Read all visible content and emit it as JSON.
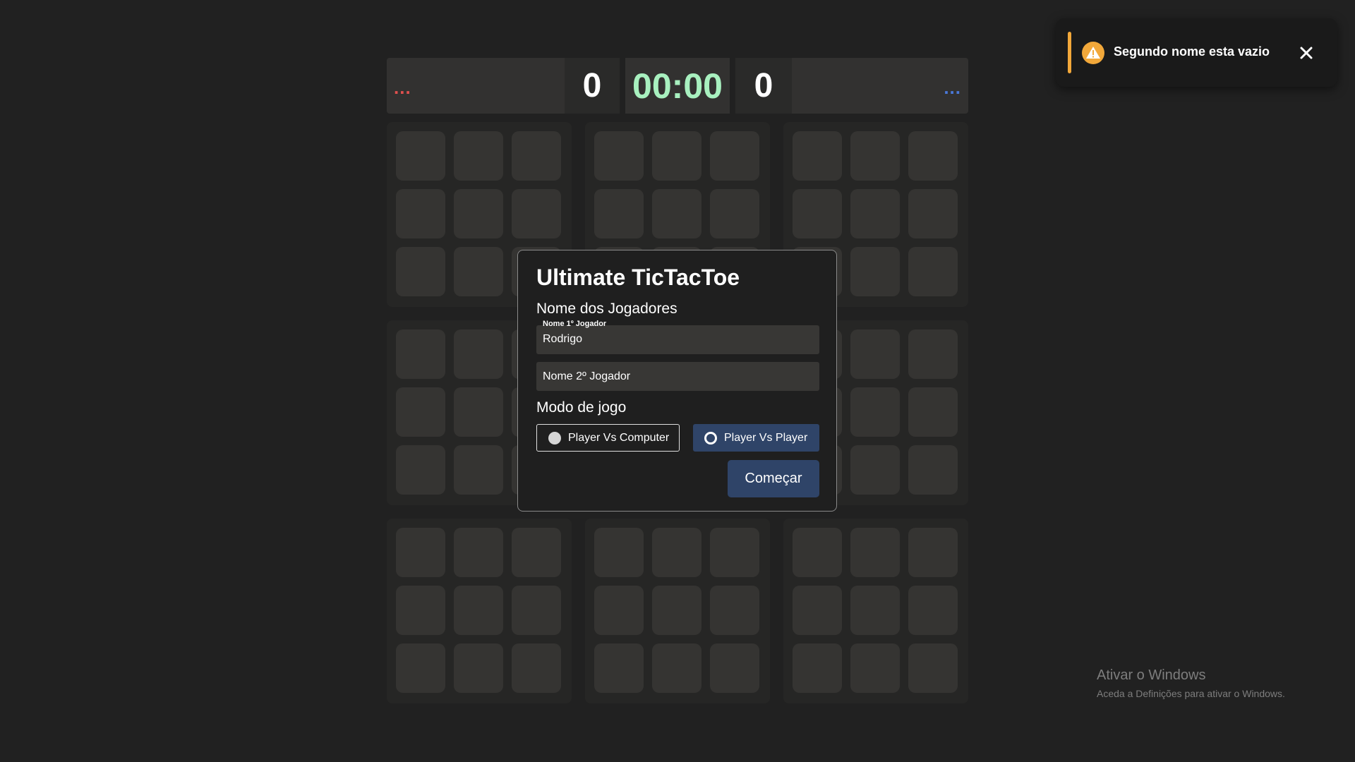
{
  "scoreboard": {
    "player1": {
      "name": "...",
      "score": "0",
      "color": "#e0504e"
    },
    "timer": {
      "value": "00:00",
      "color": "#a8f0bf"
    },
    "player2": {
      "name": "...",
      "score": "0",
      "color": "#4a78d8"
    }
  },
  "board": {
    "big_cells": 9,
    "small_cells_per_big": 9
  },
  "modal": {
    "title": "Ultimate TicTacToe",
    "names_section": "Nome dos Jogadores",
    "player1_field": {
      "label": "Nome 1º Jogador",
      "value": "Rodrigo"
    },
    "player2_field": {
      "placeholder": "Nome 2º Jogador",
      "value": ""
    },
    "mode_section": "Modo de jogo",
    "mode_options": [
      {
        "label": "Player Vs Computer",
        "selected": false
      },
      {
        "label": "Player Vs Player",
        "selected": true
      }
    ],
    "start_label": "Começar"
  },
  "toast": {
    "message": "Segundo nome esta vazio",
    "icon": "warning-icon",
    "accent": "#f2a83a"
  },
  "watermark": {
    "title": "Ativar o Windows",
    "subtitle": "Aceda a Definições para ativar o Windows."
  }
}
